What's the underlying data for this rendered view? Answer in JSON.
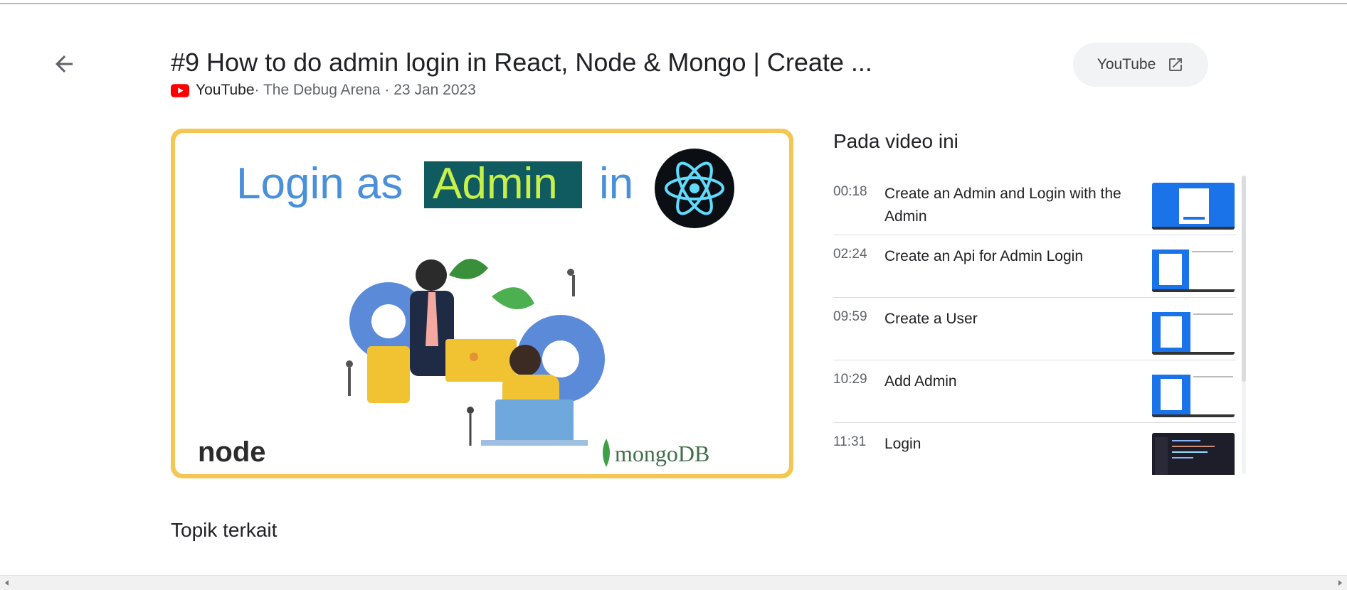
{
  "video": {
    "title": "#9 How to do admin login in React, Node & Mongo | Create ...",
    "source": "YouTube",
    "meta_rest": " · The Debug Arena · 23 Jan 2023",
    "open_button_label": "YouTube",
    "thumbnail": {
      "text_login_as": "Login as",
      "text_admin": "Admin",
      "text_in": "in",
      "logo_left": "node",
      "logo_right": "mongoDB"
    }
  },
  "chapters_heading": "Pada video ini",
  "chapters": [
    {
      "time": "00:18",
      "title": "Create an Admin and Login with the Admin"
    },
    {
      "time": "02:24",
      "title": "Create an Api for Admin Login"
    },
    {
      "time": "09:59",
      "title": "Create a User"
    },
    {
      "time": "10:29",
      "title": "Add Admin"
    },
    {
      "time": "11:31",
      "title": "Login"
    }
  ],
  "related_heading": "Topik terkait",
  "colors": {
    "accent_yellow": "#f4c653",
    "youtube_red": "#ff0000",
    "thumb_blue": "#1a73e8",
    "admin_highlight": "#0f5b5f"
  }
}
